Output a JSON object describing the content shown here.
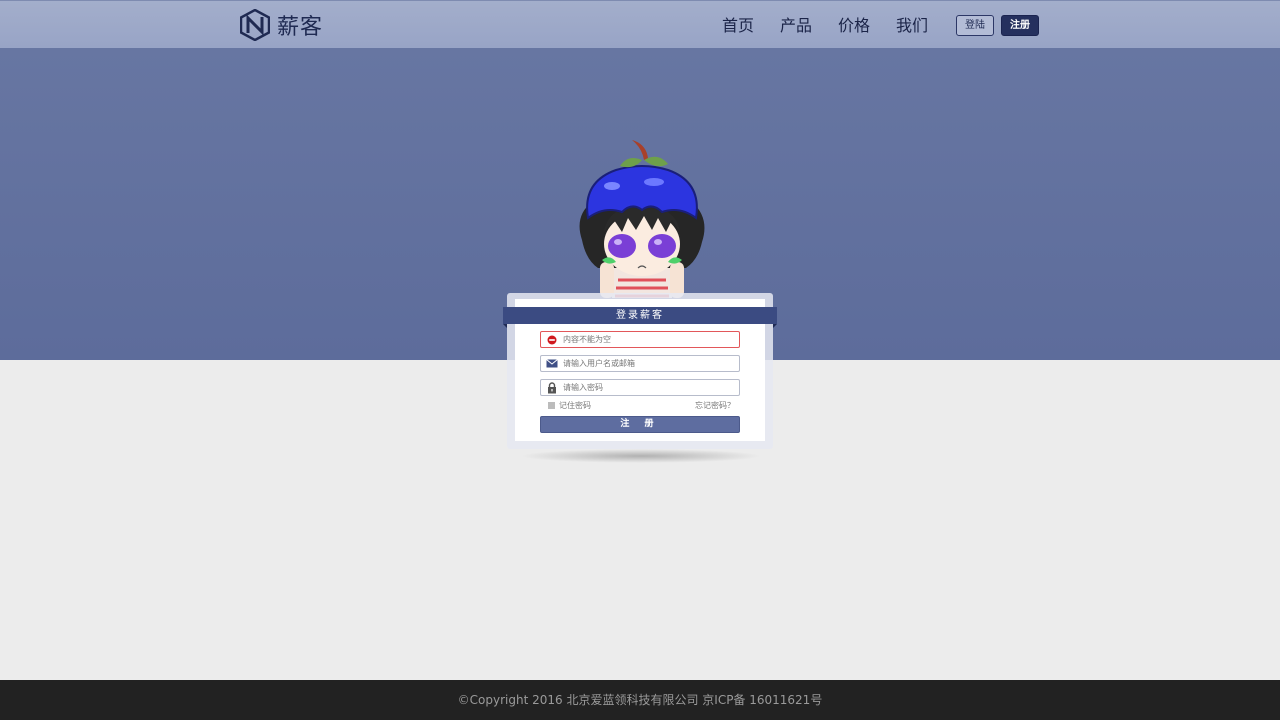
{
  "header": {
    "brand": "薪客",
    "nav": [
      "首页",
      "产品",
      "价格",
      "我们"
    ],
    "login_label": "登陆",
    "register_label": "注册"
  },
  "login_card": {
    "title": "登录薪客",
    "error_text": "内容不能为空",
    "username_placeholder": "请输入用户名或邮箱",
    "password_placeholder": "请输入密码",
    "remember_label": "记住密码",
    "forgot_label": "忘记密码？",
    "submit_label": "注 册"
  },
  "footer": {
    "copyright": "©Copyright 2016 北京爱蓝领科技有限公司 京ICP备 16011621号"
  },
  "icons": {
    "error": "error-icon",
    "username": "envelope-icon",
    "password": "lock-icon"
  },
  "colors": {
    "hero": "#6372a0",
    "nav_bar": "#9ea9c8",
    "ribbon": "#3b4b82",
    "button": "#5e6da0",
    "error": "#e2575a"
  }
}
